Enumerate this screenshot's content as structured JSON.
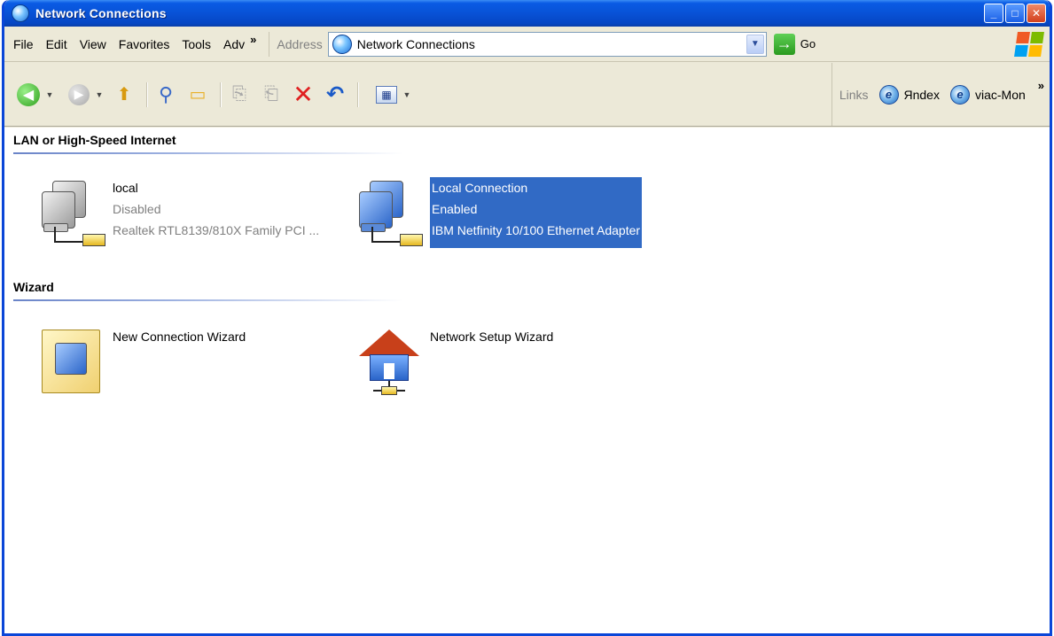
{
  "window": {
    "title": "Network Connections"
  },
  "title_buttons": {
    "minimize": "_",
    "maximize": "□",
    "close": "✕"
  },
  "menu": {
    "file": "File",
    "edit": "Edit",
    "view": "View",
    "favorites": "Favorites",
    "tools": "Tools",
    "advanced": "Adv",
    "more": "»"
  },
  "address": {
    "label": "Address",
    "value": "Network Connections",
    "go_label": "Go"
  },
  "toolbar": {
    "links_label": "Links",
    "links": [
      {
        "label": "Яndex",
        "icon": "ie-icon"
      },
      {
        "label": "viac-Mon",
        "icon": "ie-icon"
      }
    ],
    "more": "»"
  },
  "groups": {
    "lan": {
      "header": "LAN or High-Speed Internet",
      "items": [
        {
          "name": "local",
          "status": "Disabled",
          "device": "Realtek RTL8139/810X Family PCI ...",
          "selected": false,
          "icon": "network-connection-disabled-icon"
        },
        {
          "name": "Local Connection",
          "status": "Enabled",
          "device": "IBM Netfinity 10/100 Ethernet Adapter",
          "selected": true,
          "icon": "network-connection-enabled-icon"
        }
      ]
    },
    "wizard": {
      "header": "Wizard",
      "items": [
        {
          "name": "New Connection Wizard",
          "icon": "new-connection-wizard-icon"
        },
        {
          "name": "Network Setup Wizard",
          "icon": "network-setup-wizard-icon"
        }
      ]
    }
  },
  "colors": {
    "title_bar": "#0852d6",
    "selection": "#316ac5",
    "group_line": "#6a84c8"
  }
}
